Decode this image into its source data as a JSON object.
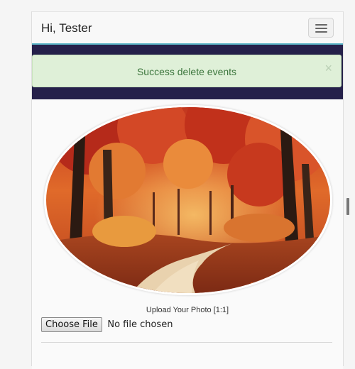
{
  "header": {
    "greeting": "Hi, Tester",
    "menu_icon": "hamburger-icon"
  },
  "alert": {
    "message": "Success delete events",
    "close_symbol": "×",
    "color": "#3c763d",
    "background": "#dff0d8"
  },
  "profile": {
    "photo_icon": "autumn-forest-path-photo",
    "upload_caption": "Upload Your Photo [1:1]",
    "choose_file_label": "Choose File",
    "file_status": "No file chosen"
  },
  "colors": {
    "banner": "#25204a",
    "banner_accent": "#5cb6c8"
  }
}
